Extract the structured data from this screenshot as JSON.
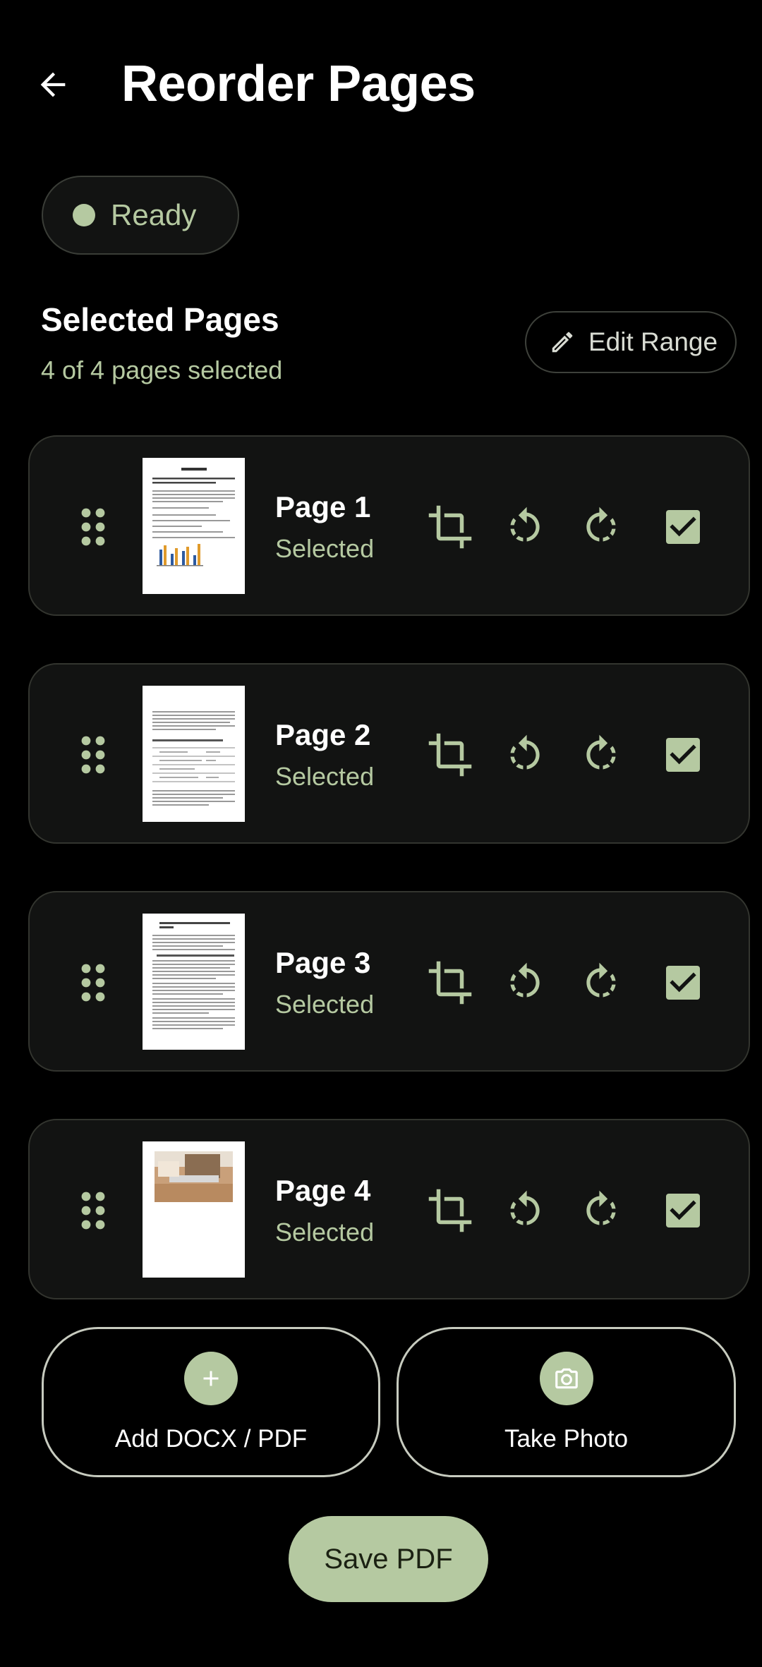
{
  "header": {
    "title": "Reorder Pages",
    "back_icon": "arrow-left-icon"
  },
  "status": {
    "label": "Ready",
    "dot_color": "#b5c9a1"
  },
  "section": {
    "title": "Selected Pages",
    "subtitle": "4 of 4 pages selected",
    "edit_label": "Edit Range"
  },
  "pages": [
    {
      "title": "Page 1",
      "status": "Selected",
      "checked": true
    },
    {
      "title": "Page 2",
      "status": "Selected",
      "checked": true
    },
    {
      "title": "Page 3",
      "status": "Selected",
      "checked": true
    },
    {
      "title": "Page 4",
      "status": "Selected",
      "checked": true
    }
  ],
  "actions": {
    "add_label": "Add DOCX / PDF",
    "photo_label": "Take Photo"
  },
  "save_label": "Save PDF",
  "colors": {
    "accent": "#b5c9a1",
    "card_bg": "#121312",
    "background": "#000000"
  }
}
